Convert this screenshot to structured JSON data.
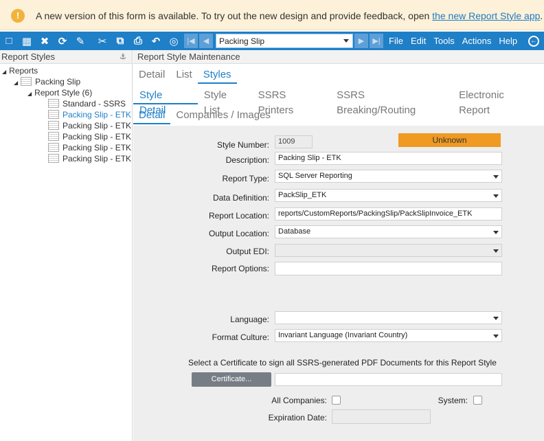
{
  "banner": {
    "icon": "warning-icon",
    "message": "A new version of this form is available. To try out the new design and provide feedback, open ",
    "link_text": "the new Report Style app",
    "suffix": "."
  },
  "toolbar": {
    "selected_report": "Packing Slip",
    "menus": [
      "File",
      "Edit",
      "Tools",
      "Actions",
      "Help"
    ]
  },
  "left_panel": {
    "title": "Report Styles",
    "tree": {
      "root": "Reports",
      "child": "Packing Slip",
      "group": "Report Style (6)",
      "items": [
        "Standard - SSRS",
        "Packing Slip - ETK",
        "Packing Slip - ETK",
        "Packing Slip - ETK",
        "Packing Slip - ETK",
        "Packing Slip - ETK"
      ],
      "selected_index": 1
    }
  },
  "main": {
    "title": "Report Style Maintenance",
    "tabs_top": [
      "Detail",
      "List",
      "Styles"
    ],
    "tabs_mid": [
      "Style Detail",
      "Style List",
      "SSRS Printers",
      "SSRS Breaking/Routing",
      "Electronic Report"
    ],
    "tabs_sub": [
      "Detail",
      "Companies / Images"
    ]
  },
  "form": {
    "style_number": {
      "label": "Style Number:",
      "value": "1009"
    },
    "status": "Unknown",
    "description": {
      "label": "Description:",
      "value": "Packing Slip - ETK"
    },
    "report_type": {
      "label": "Report Type:",
      "value": "SQL Server Reporting"
    },
    "data_definition": {
      "label": "Data Definition:",
      "value": "PackSlip_ETK"
    },
    "report_location": {
      "label": "Report Location:",
      "value": "reports/CustomReports/PackingSlip/PackSlipInvoice_ETK"
    },
    "output_location": {
      "label": "Output Location:",
      "value": "Database"
    },
    "output_edi": {
      "label": "Output EDI:",
      "value": ""
    },
    "report_options": {
      "label": "Report Options:",
      "value": ""
    },
    "language": {
      "label": "Language:",
      "value": ""
    },
    "format_culture": {
      "label": "Format Culture:",
      "value": "Invariant Language (Invariant Country)"
    },
    "certificate_prompt": "Select a Certificate to sign all SSRS-generated PDF Documents for this Report Style",
    "certificate_button": "Certificate...",
    "certificate_value": "",
    "all_companies_label": "All Companies:",
    "system_label": "System:",
    "expiration_label": "Expiration Date:",
    "expiration_value": ""
  }
}
